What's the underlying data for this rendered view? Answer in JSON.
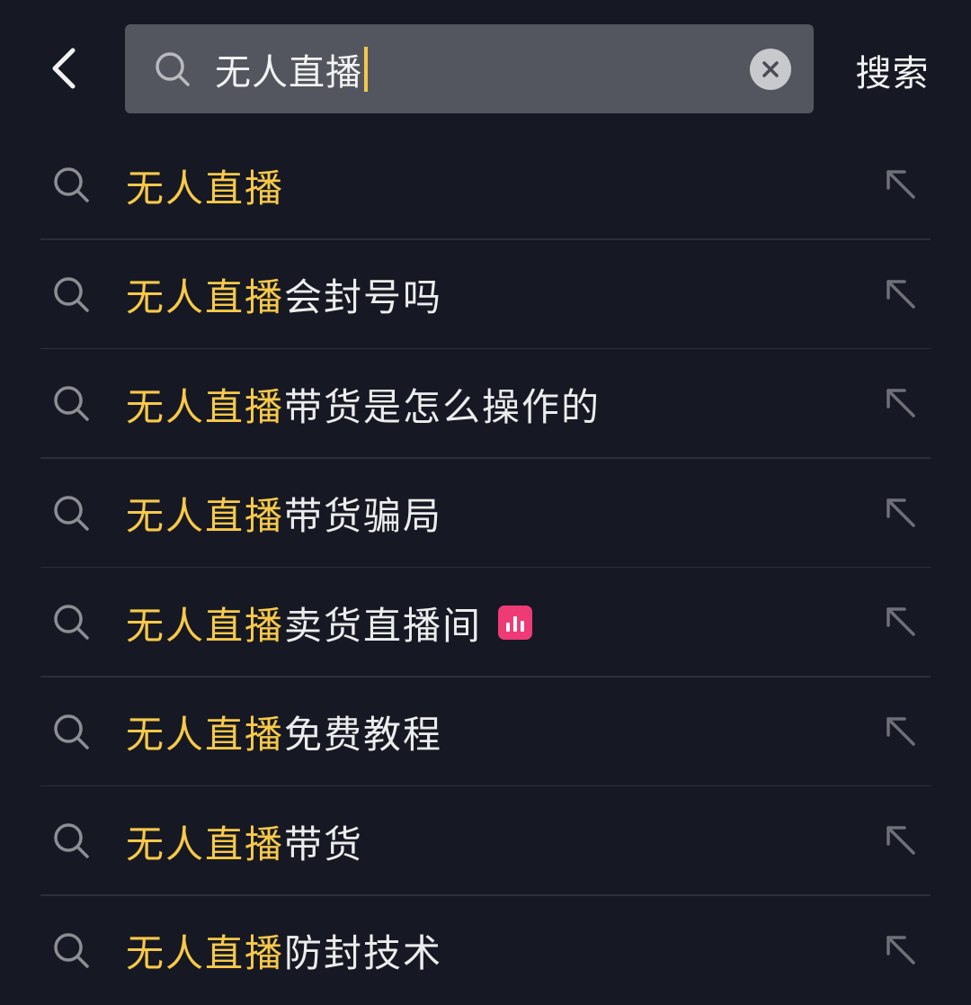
{
  "search": {
    "query": "无人直播",
    "submit_label": "搜索",
    "icons": {
      "back": "chevron-left-icon",
      "search": "search-icon",
      "clear": "clear-icon"
    }
  },
  "colors": {
    "background": "#161823",
    "search_box": "#54565f",
    "highlight": "#f7c949",
    "caret": "#f3c84b",
    "live_badge": "#ee3b76"
  },
  "suggestions": [
    {
      "highlight": "无人直播",
      "rest": "",
      "live_badge": false
    },
    {
      "highlight": "无人直播",
      "rest": "会封号吗",
      "live_badge": false
    },
    {
      "highlight": "无人直播",
      "rest": "带货是怎么操作的",
      "live_badge": false
    },
    {
      "highlight": "无人直播",
      "rest": "带货骗局",
      "live_badge": false
    },
    {
      "highlight": "无人直播",
      "rest": "卖货直播间",
      "live_badge": true
    },
    {
      "highlight": "无人直播",
      "rest": "免费教程",
      "live_badge": false
    },
    {
      "highlight": "无人直播",
      "rest": "带货",
      "live_badge": false
    },
    {
      "highlight": "无人直播",
      "rest": "防封技术",
      "live_badge": false
    }
  ]
}
